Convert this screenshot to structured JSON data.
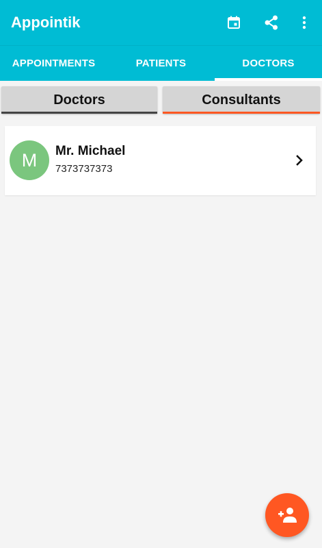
{
  "app": {
    "title": "Appointik",
    "actions": [
      {
        "icon": "calendar-icon"
      },
      {
        "icon": "share-icon"
      },
      {
        "icon": "more-vert-icon"
      }
    ]
  },
  "tabs": [
    {
      "label": "APPOINTMENTS",
      "selected": false
    },
    {
      "label": "PATIENTS",
      "selected": false
    },
    {
      "label": "DOCTORS",
      "selected": true
    }
  ],
  "subtabs": [
    {
      "label": "Doctors",
      "selected": false
    },
    {
      "label": "Consultants",
      "selected": true
    }
  ],
  "list": [
    {
      "initial": "M",
      "name": "Mr. Michael",
      "phone": "7373737373"
    }
  ],
  "fab": {
    "icon": "add-person-icon"
  },
  "colors": {
    "primary": "#00bcd4",
    "accent": "#ff5722",
    "avatar": "#7bc67e",
    "background": "#f4f4f4"
  }
}
